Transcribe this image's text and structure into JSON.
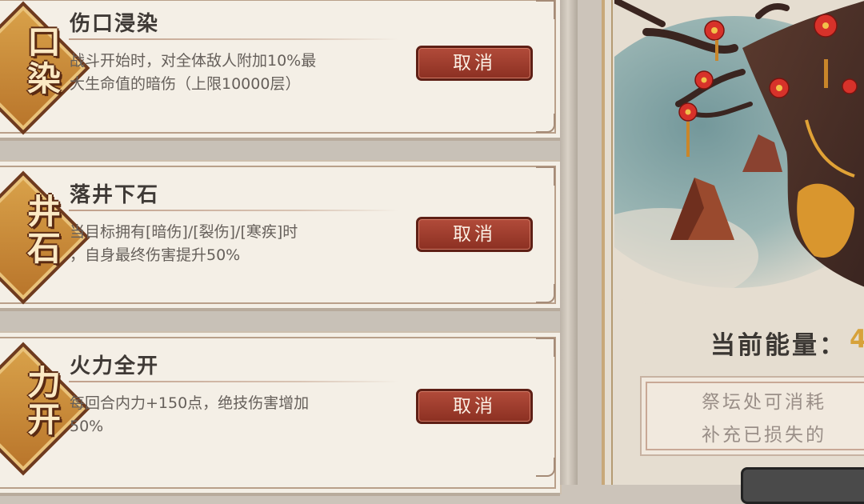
{
  "skills": [
    {
      "emblem": "口染",
      "title": "伤口浸染",
      "desc_lines": [
        "战斗开始时，对全体敌人附加10%最",
        "大生命值的暗伤（上限10000层）"
      ],
      "button": "取消"
    },
    {
      "emblem": "井石",
      "title": "落井下石",
      "desc_lines": [
        "当目标拥有[暗伤]/[裂伤]/[寒疾]时",
        "，自身最终伤害提升50%"
      ],
      "button": "取消"
    },
    {
      "emblem": "力开",
      "title": "火力全开",
      "desc_lines": [
        "每回合内力+150点，绝技伤害增加",
        "50%"
      ],
      "button": "取消"
    }
  ],
  "altar": {
    "energy_label": "当前能量：",
    "energy_value": "4",
    "info_lines": [
      "祭坛处可消耗",
      "补充已损失的"
    ]
  },
  "colors": {
    "button_red": "#9c3a2b",
    "card_bg": "#f4efe6",
    "blossom_red": "#d7322a",
    "energy_gold": "#d7a23a"
  }
}
